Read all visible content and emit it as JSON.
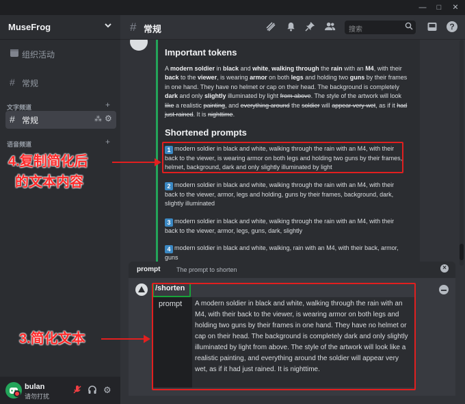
{
  "window": {
    "controls": [
      "—",
      "□",
      "✕"
    ]
  },
  "server": {
    "name": "MuseFrog",
    "menu_icon": "chevron-down-icon"
  },
  "sidebar": {
    "items": [
      {
        "icon": "calendar-icon",
        "label": "组织活动"
      },
      {
        "icon": "hash-icon",
        "label": "常规"
      }
    ],
    "categories": [
      {
        "label": "文字频道",
        "channels": [
          {
            "name": "常规",
            "active": true
          }
        ]
      },
      {
        "label": "语音频道",
        "channels": []
      }
    ]
  },
  "user": {
    "name": "bulan",
    "status": "请勿打扰",
    "controls": [
      "mic-muted-icon",
      "headphones-icon",
      "gear-icon"
    ]
  },
  "channel": {
    "name": "常规",
    "header_icons": [
      "threads-icon",
      "bell-icon",
      "pin-icon",
      "members-icon"
    ],
    "search_placeholder": "搜索",
    "right_icons": [
      "inbox-icon",
      "help-icon"
    ]
  },
  "embed": {
    "important_title": "Important tokens",
    "shortened_title": "Shortened prompts",
    "prompts": [
      {
        "num": "1",
        "text": "modern soldier in black and white, walking through the rain with an M4, with their back to the viewer, is wearing armor on both legs and holding two guns by their frames, helmet, background, dark and only slightly illuminated by light"
      },
      {
        "num": "2",
        "text": "modern soldier in black and white, walking through the rain with an M4, with their back to the viewer, armor, legs and holding, guns by their frames, background, dark, slightly illuminated"
      },
      {
        "num": "3",
        "text": "modern soldier in black and white, walking through the rain with an M4, with their back to the viewer, armor, legs, guns, dark, slightly"
      },
      {
        "num": "4",
        "text": "modern soldier in black and white, walking, rain with an M4, with their back, armor, guns"
      }
    ]
  },
  "command": {
    "popup_name": "prompt",
    "popup_desc": "The prompt to shorten",
    "name": "/shorten",
    "param_label": "prompt",
    "param_value": "A modern soldier in black and white, walking through the rain with an M4, with their back to the viewer, is wearing armor on both legs and holding two guns by their frames in one hand. They have no helmet or cap on their head. The background is completely dark and only slightly illuminated by light from above. The style of the artwork will look like a realistic painting, and everything around the soldier will appear very wet, as if it had just rained. It is nighttime."
  },
  "annotations": {
    "step4_line1": "4.复制简化后",
    "step4_line2": "的文本内容",
    "step3": "3.简化文本"
  },
  "colors": {
    "annotation_red": "#e21f1f",
    "command_green": "#18a33a",
    "embed_bar": "#23a55a",
    "number_badge": "#3b88c3"
  }
}
